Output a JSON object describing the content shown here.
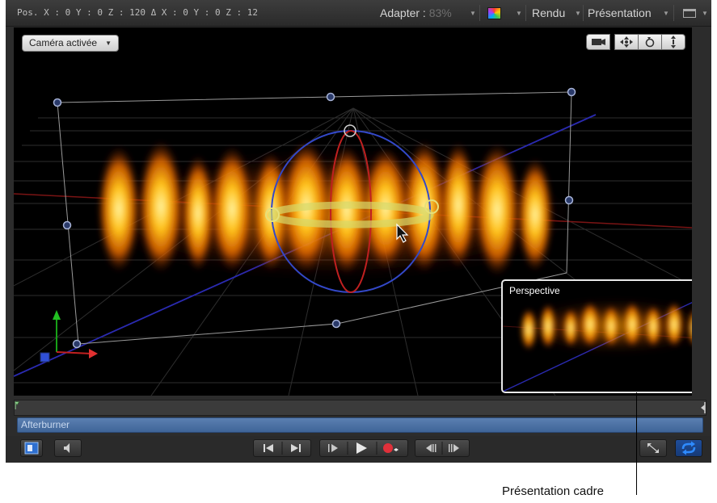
{
  "topbar": {
    "position_readout": "Pos. X : 0  Y : 0  Z : 120   Δ X : 0  Y : 0  Z : 12",
    "fit_label": "Adapter :",
    "fit_value": "83%",
    "render_label": "Rendu",
    "view_label": "Présentation"
  },
  "viewport": {
    "camera_menu_label": "Caméra activée",
    "minimap_label": "Perspective"
  },
  "timeline": {
    "clip_name": "Afterburner"
  },
  "callout": {
    "label": "Présentation cadre"
  },
  "colors": {
    "clip_blue": "#4a6fa3",
    "loop_active": "#2e8bff",
    "record_red": "#e0303a",
    "gizmo_blue": "#3348c8",
    "gizmo_red": "#c02020",
    "ring_yellow": "#d6d86a"
  },
  "icons": {
    "camera": "camera-icon",
    "pan": "pan-icon",
    "orbit": "orbit-icon",
    "dolly": "dolly-icon",
    "play": "play-icon",
    "record": "record-icon",
    "loop": "loop-icon"
  }
}
